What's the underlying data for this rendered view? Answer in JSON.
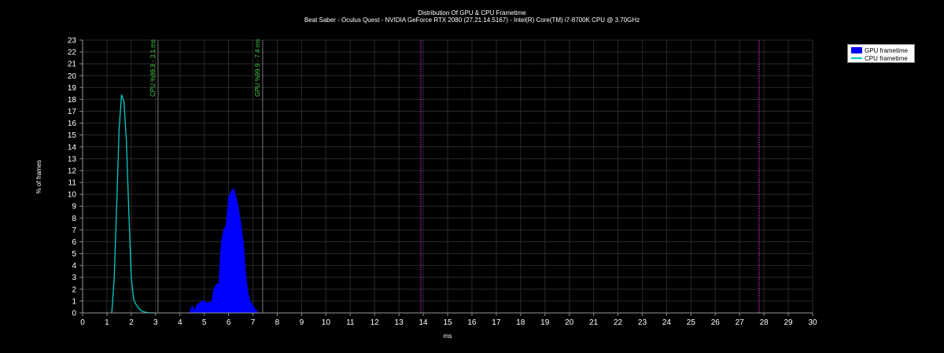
{
  "chart_data": {
    "type": "area",
    "title": "Distribution Of GPU & CPU Frametime",
    "subtitle": "Beat Saber - Oculus Quest - NVIDIA GeForce RTX 2080 (27.21.14.5167) - Intel(R) Core(TM) i7-8700K CPU @ 3.70GHz",
    "xlabel": "ms",
    "ylabel": "% of frames",
    "xlim": [
      0,
      30
    ],
    "ylim": [
      0,
      23
    ],
    "xticks": [
      "0",
      "1",
      "2",
      "3",
      "4",
      "5",
      "6",
      "7",
      "8",
      "9",
      "10",
      "11",
      "12",
      "13",
      "14",
      "15",
      "16",
      "17",
      "18",
      "19",
      "20",
      "21",
      "22",
      "23",
      "24",
      "25",
      "26",
      "27",
      "28",
      "29",
      "30"
    ],
    "yticks": [
      "0",
      "1",
      "2",
      "3",
      "4",
      "5",
      "6",
      "7",
      "8",
      "9",
      "10",
      "11",
      "12",
      "13",
      "14",
      "15",
      "16",
      "17",
      "18",
      "19",
      "20",
      "21",
      "22",
      "23"
    ],
    "grid": true,
    "legend_position": "top-right",
    "series": [
      {
        "name": "GPU frametime",
        "color": "#0000ff",
        "style": "filled-area",
        "x": [
          4.4,
          4.5,
          4.6,
          4.7,
          4.8,
          4.9,
          5.0,
          5.1,
          5.2,
          5.3,
          5.4,
          5.5,
          5.6,
          5.7,
          5.8,
          5.9,
          6.0,
          6.1,
          6.2,
          6.3,
          6.4,
          6.5,
          6.6,
          6.7,
          6.8,
          6.9,
          7.0,
          7.1,
          7.2
        ],
        "y": [
          0,
          0.6,
          0.2,
          0.7,
          0.8,
          1.0,
          1.0,
          0.8,
          0.9,
          0.9,
          2.0,
          2.4,
          2.5,
          5.9,
          7.0,
          7.4,
          9.7,
          10.2,
          10.5,
          9.8,
          8.9,
          7.5,
          6.0,
          3.3,
          1.6,
          0.9,
          0.6,
          0.3,
          0
        ]
      },
      {
        "name": "CPU frametime",
        "color": "#00cccc",
        "style": "line",
        "x": [
          1.2,
          1.3,
          1.4,
          1.5,
          1.6,
          1.7,
          1.8,
          1.9,
          2.0,
          2.1,
          2.2,
          2.3,
          2.4,
          2.5,
          2.6,
          2.7,
          2.8,
          3.0
        ],
        "y": [
          0,
          3.0,
          9.0,
          15.5,
          18.4,
          17.8,
          14.5,
          8.5,
          3.0,
          1.1,
          0.7,
          0.4,
          0.2,
          0.1,
          0.05,
          0.02,
          0,
          0
        ]
      }
    ],
    "vlines": [
      {
        "x": 3.1,
        "label": "CPU %99.9 - 3.1  ms",
        "color": "#777777",
        "label_color": "#44cc44"
      },
      {
        "x": 7.4,
        "label": "GPU %99.9 - 7.4 ms",
        "color": "#777777",
        "label_color": "#44cc44"
      },
      {
        "x": 13.9,
        "label": "",
        "color": "#cc22cc"
      },
      {
        "x": 27.8,
        "label": "",
        "color": "#cc22cc"
      }
    ]
  }
}
